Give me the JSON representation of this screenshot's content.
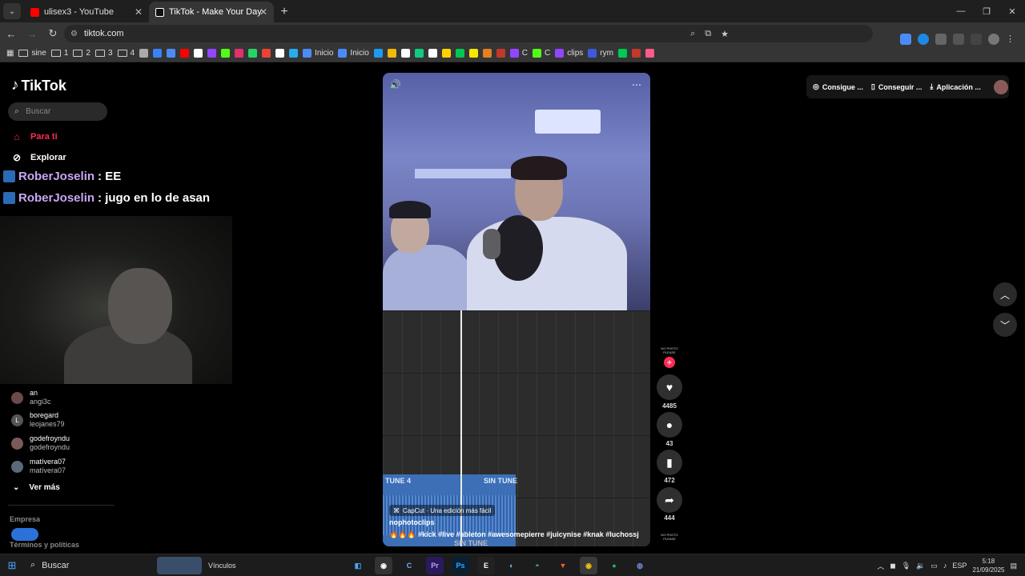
{
  "browser": {
    "tabs": [
      {
        "title": "ulisex3 - YouTube",
        "icon": "youtube-icon",
        "color": "#ff0000",
        "active": false
      },
      {
        "title": "TikTok - Make Your Day",
        "icon": "tiktok-icon",
        "color": "#ffffff",
        "active": true
      }
    ],
    "url": "tiktok.com",
    "bookmarks": [
      {
        "label": "sine",
        "type": "folder"
      },
      {
        "label": "1",
        "type": "folder"
      },
      {
        "label": "2",
        "type": "folder"
      },
      {
        "label": "3",
        "type": "folder"
      },
      {
        "label": "4",
        "type": "folder"
      },
      {
        "label": "",
        "type": "site",
        "color": "#aaaaaa"
      },
      {
        "label": "",
        "type": "site",
        "color": "#3b82f6"
      },
      {
        "label": "",
        "type": "site",
        "color": "#4c8bf5"
      },
      {
        "label": "",
        "type": "site",
        "color": "#ff0000"
      },
      {
        "label": "",
        "type": "site",
        "color": "#ffffff"
      },
      {
        "label": "",
        "type": "site",
        "color": "#9146ff"
      },
      {
        "label": "",
        "type": "site",
        "color": "#53fc18"
      },
      {
        "label": "",
        "type": "site",
        "color": "#e1306c"
      },
      {
        "label": "",
        "type": "site",
        "color": "#25d366"
      },
      {
        "label": "",
        "type": "site",
        "color": "#ea4335"
      },
      {
        "label": "",
        "type": "site",
        "color": "#ffffff"
      },
      {
        "label": "",
        "type": "site",
        "color": "#2aabee"
      },
      {
        "label": "Inicio",
        "type": "site",
        "color": "#4c8bf5"
      },
      {
        "label": "Inicio",
        "type": "site",
        "color": "#4c8bf5"
      },
      {
        "label": "",
        "type": "site",
        "color": "#1d9bf0"
      },
      {
        "label": "",
        "type": "site",
        "color": "#f0b90b"
      },
      {
        "label": "",
        "type": "site",
        "color": "#ffffff"
      },
      {
        "label": "",
        "type": "site",
        "color": "#0ecb81"
      },
      {
        "label": "",
        "type": "site",
        "color": "#ffffff"
      },
      {
        "label": "",
        "type": "site",
        "color": "#ffd200"
      },
      {
        "label": "",
        "type": "site",
        "color": "#00c853"
      },
      {
        "label": "",
        "type": "site",
        "color": "#f7e600"
      },
      {
        "label": "",
        "type": "site",
        "color": "#e67e22"
      },
      {
        "label": "",
        "type": "site",
        "color": "#c0392b"
      },
      {
        "label": "C",
        "type": "site",
        "color": "#9146ff"
      },
      {
        "label": "C",
        "type": "site",
        "color": "#53fc18"
      },
      {
        "label": "clips",
        "type": "site",
        "color": "#9146ff"
      },
      {
        "label": "rym",
        "type": "site",
        "color": "#3b5bdb"
      },
      {
        "label": "",
        "type": "site",
        "color": "#00c853"
      },
      {
        "label": "",
        "type": "site",
        "color": "#c0392b"
      },
      {
        "label": "",
        "type": "site",
        "color": "#ff5a8a"
      }
    ]
  },
  "tiktok": {
    "logo": "TikTok",
    "search_placeholder": "Buscar",
    "nav": [
      {
        "label": "Para ti",
        "icon": "home-icon",
        "active": true
      },
      {
        "label": "Explorar",
        "icon": "compass-icon",
        "active": false
      }
    ],
    "overlay_chat": [
      {
        "user": "RoberJoselin",
        "message": ": EE"
      },
      {
        "user": "RoberJoselin",
        "message": ": jugo en lo de asan"
      }
    ],
    "following": [
      {
        "name": "an",
        "handle": "angi3c"
      },
      {
        "name": "boregard",
        "handle": "leojanes79",
        "initial": "L"
      },
      {
        "name": "godefroyndu",
        "handle": "godefroyndu"
      },
      {
        "name": "matívera07",
        "handle": "matívera07"
      }
    ],
    "see_more": "Ver más",
    "footer": {
      "company": "Empresa",
      "terms": "Términos y políticas"
    },
    "top_right": [
      {
        "label": "Consigue ...",
        "icon": "coin-icon"
      },
      {
        "label": "Conseguir ...",
        "icon": "phone-icon"
      },
      {
        "label": "Aplicación ...",
        "icon": "download-icon"
      }
    ],
    "video": {
      "clip_labels": [
        "TUNE 4",
        "SIN TUNE"
      ],
      "bottom_label": "SIN TUNE",
      "capcut": "CapCut · Una edición más fácil",
      "author": "nophotoclips",
      "caption": "🔥🔥🔥 #kick #live #ableton #awesomepierre #juicynise #knak #luchossj",
      "rail_label": "NO PHOTO PLEASE",
      "likes": "4485",
      "comments": "43",
      "saves": "472",
      "shares": "444"
    }
  },
  "taskbar": {
    "search": "Buscar",
    "widget_label": "Vínculos",
    "language": "ESP",
    "time": "5:18",
    "date": "21/09/2025"
  }
}
